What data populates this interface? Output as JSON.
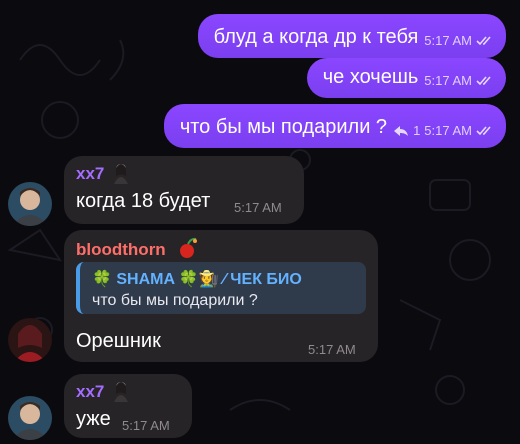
{
  "colors": {
    "outgoing_bubble": "#8a46ff",
    "incoming_bubble": "#272427",
    "sender_xx7": "#a46dff",
    "sender_bloodthorn": "#ff6f6a",
    "quote_accent": "#4b9ce8",
    "background": "#0b0a0f"
  },
  "messages": {
    "out1": {
      "text": "блуд а когда др к тебя",
      "time": "5:17 AM"
    },
    "out2": {
      "text": "че хочешь",
      "time": "5:17 AM"
    },
    "out3": {
      "text": "что бы мы подарили ?",
      "reply_count": "1",
      "time": "5:17 AM"
    },
    "in1": {
      "sender": "xx7",
      "text": "когда 18 будет",
      "time": "5:17 AM"
    },
    "in2": {
      "sender": "bloodthorn",
      "quote_name": "🍀 SHAMA 🍀🧑‍🌾 ⁄ ЧЕК БИО",
      "quote_text": "что бы мы подарили ?",
      "text": "Орешник",
      "time": "5:17 AM"
    },
    "in3": {
      "sender": "xx7",
      "text": "уже",
      "time": "5:17 AM"
    }
  },
  "icons": {
    "read_ticks": "double-check-icon",
    "reply_arrow": "reply-arrow-icon",
    "sender_emoji_1": "person-emoji-icon",
    "sender_emoji_2": "cherry-bomb-emoji-icon"
  }
}
